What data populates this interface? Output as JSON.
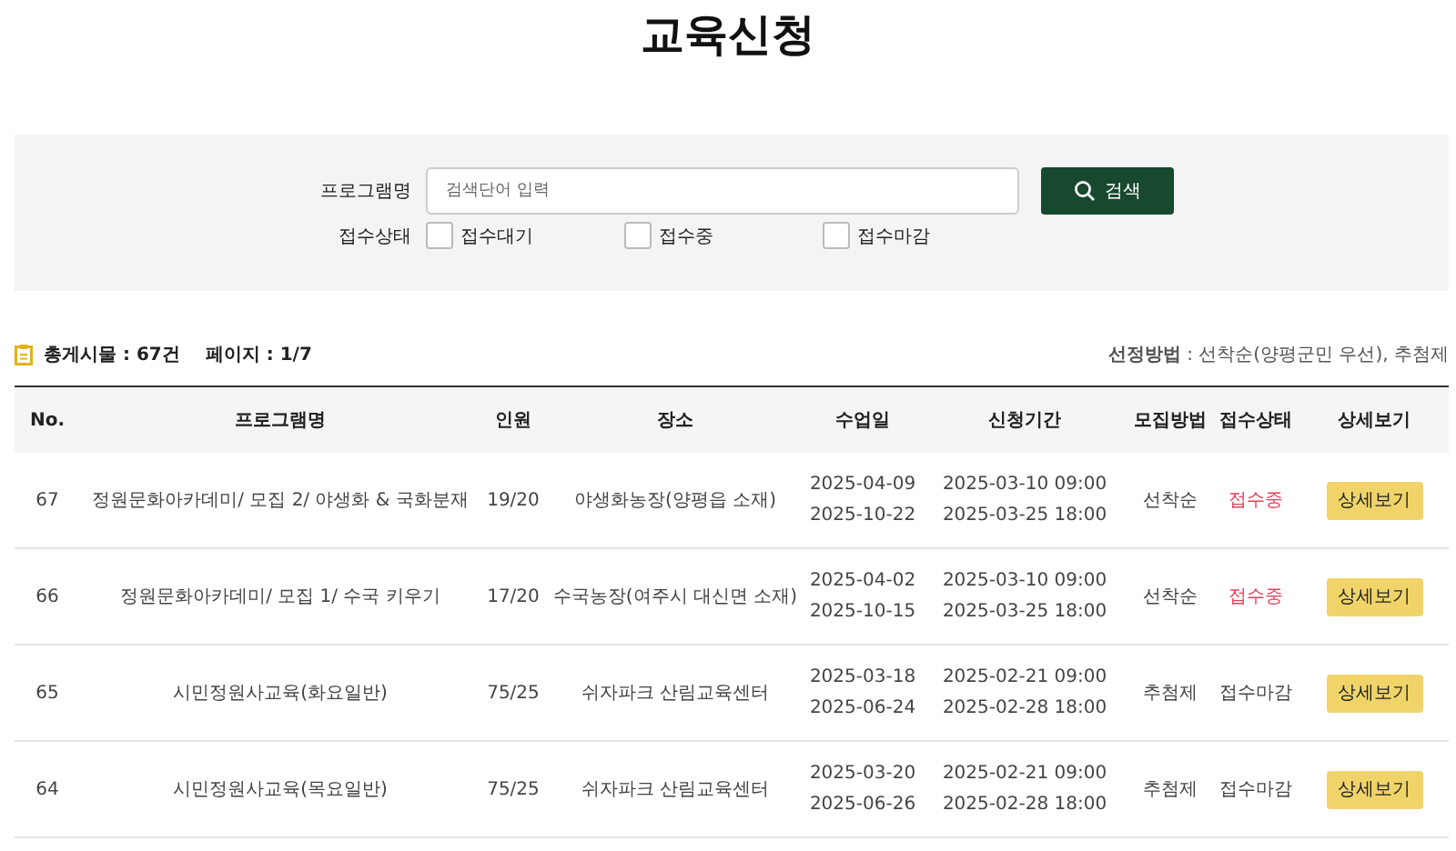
{
  "title": "교육신청",
  "search": {
    "label": "프로그램명",
    "placeholder": "검색단어 입력",
    "button": "검색"
  },
  "status_filter": {
    "label": "접수상태",
    "options": [
      {
        "label": "접수대기",
        "checked": false
      },
      {
        "label": "접수중",
        "checked": false
      },
      {
        "label": "접수마감",
        "checked": false
      }
    ]
  },
  "summary": {
    "total": "총게시물 : 67건",
    "page": "페이지 : 1/7",
    "method_label": "선정방법",
    "method_value": " : 선착순(양평군민 우선), 추첨제"
  },
  "table": {
    "columns": [
      "No.",
      "프로그램명",
      "인원",
      "장소",
      "수업일",
      "신청기간",
      "모집방법",
      "접수상태",
      "상세보기"
    ],
    "rows": [
      {
        "no": "67",
        "program": "정원문화아카데미/ 모집 2/ 야생화 & 국화분재",
        "people": "19/20",
        "place": "야생화농장(양평읍 소재)",
        "class_dates": [
          "2025-04-09",
          "2025-10-22"
        ],
        "period": [
          "2025-03-10 09:00",
          "2025-03-25 18:00"
        ],
        "method": "선착순",
        "status": {
          "text": "접수중",
          "kind": "open"
        },
        "detail": "상세보기"
      },
      {
        "no": "66",
        "program": "정원문화아카데미/ 모집 1/ 수국 키우기",
        "people": "17/20",
        "place": "수국농장(여주시 대신면 소재)",
        "class_dates": [
          "2025-04-02",
          "2025-10-15"
        ],
        "period": [
          "2025-03-10 09:00",
          "2025-03-25 18:00"
        ],
        "method": "선착순",
        "status": {
          "text": "접수중",
          "kind": "open"
        },
        "detail": "상세보기"
      },
      {
        "no": "65",
        "program": "시민정원사교육(화요일반)",
        "people": "75/25",
        "place": "쉬자파크 산림교육센터",
        "class_dates": [
          "2025-03-18",
          "2025-06-24"
        ],
        "period": [
          "2025-02-21 09:00",
          "2025-02-28 18:00"
        ],
        "method": "추첨제",
        "status": {
          "text": "접수마감",
          "kind": "closed"
        },
        "detail": "상세보기"
      },
      {
        "no": "64",
        "program": "시민정원사교육(목요일반)",
        "people": "75/25",
        "place": "쉬자파크 산림교육센터",
        "class_dates": [
          "2025-03-20",
          "2025-06-26"
        ],
        "period": [
          "2025-02-21 09:00",
          "2025-02-28 18:00"
        ],
        "method": "추첨제",
        "status": {
          "text": "접수마감",
          "kind": "closed"
        },
        "detail": "상세보기"
      }
    ]
  }
}
